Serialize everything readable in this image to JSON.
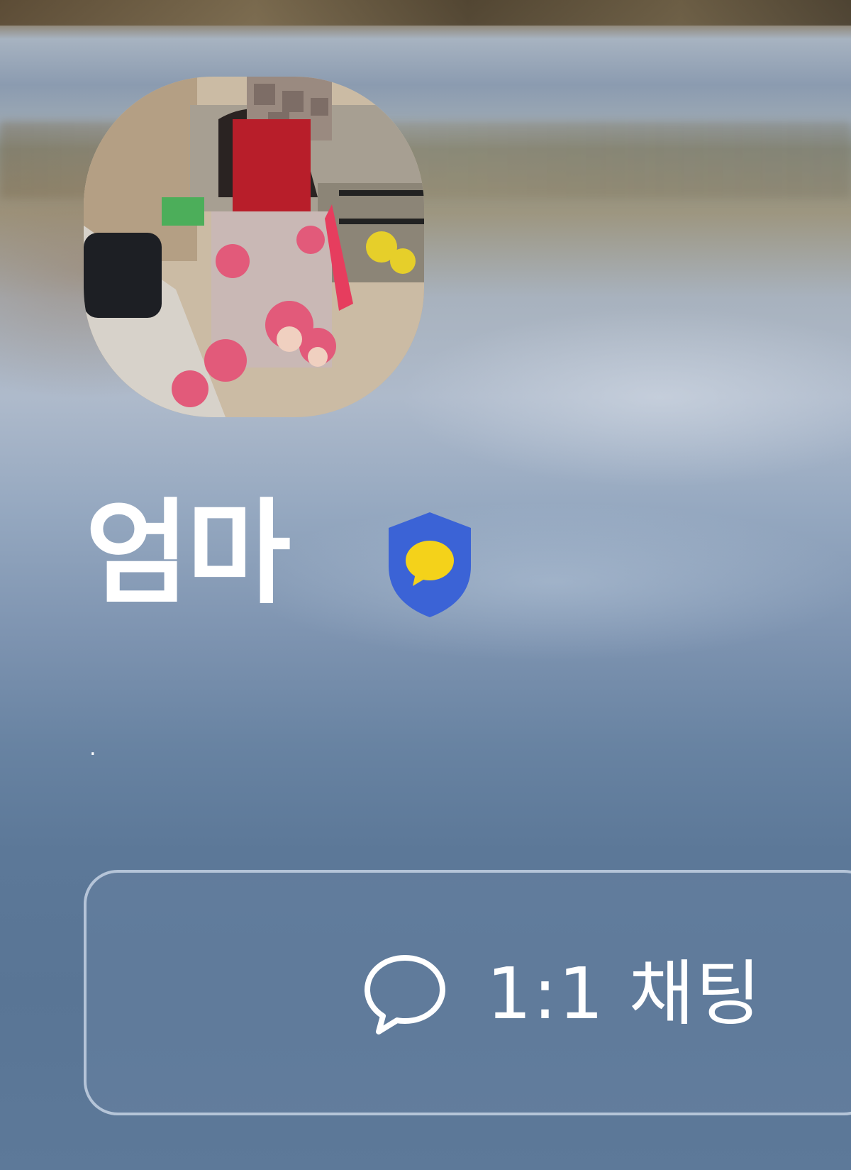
{
  "profile": {
    "name": "엄마",
    "status_message": "."
  },
  "badge": {
    "icon": "shield-chat-badge-icon",
    "shield_color": "#3b63d6",
    "bubble_color": "#f4d21a"
  },
  "actions": {
    "chat_button_label": "1:1 채팅",
    "chat_icon": "speech-bubble-icon"
  }
}
